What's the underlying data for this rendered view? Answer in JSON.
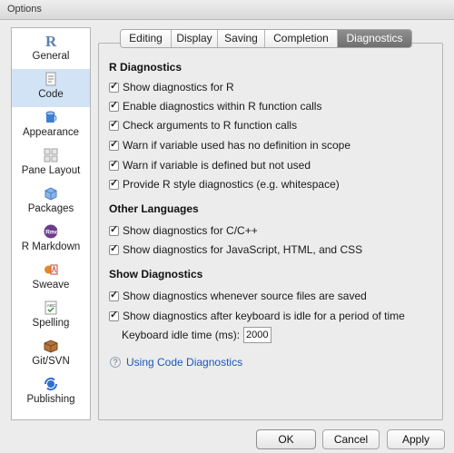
{
  "window": {
    "title": "Options"
  },
  "sidebar": {
    "items": [
      {
        "label": "General",
        "icon": "r-logo-icon",
        "selected": false
      },
      {
        "label": "Code",
        "icon": "code-doc-icon",
        "selected": true
      },
      {
        "label": "Appearance",
        "icon": "paint-bucket-icon",
        "selected": false
      },
      {
        "label": "Pane Layout",
        "icon": "pane-layout-icon",
        "selected": false
      },
      {
        "label": "Packages",
        "icon": "package-box-icon",
        "selected": false
      },
      {
        "label": "R Markdown",
        "icon": "rmd-icon",
        "selected": false
      },
      {
        "label": "Sweave",
        "icon": "sweave-icon",
        "selected": false
      },
      {
        "label": "Spelling",
        "icon": "spellcheck-icon",
        "selected": false
      },
      {
        "label": "Git/SVN",
        "icon": "git-box-icon",
        "selected": false
      },
      {
        "label": "Publishing",
        "icon": "publishing-icon",
        "selected": false
      }
    ]
  },
  "tabs": [
    {
      "label": "Editing",
      "active": false
    },
    {
      "label": "Display",
      "active": false
    },
    {
      "label": "Saving",
      "active": false
    },
    {
      "label": "Completion",
      "active": false
    },
    {
      "label": "Diagnostics",
      "active": true
    }
  ],
  "sections": {
    "r_diagnostics": {
      "title": "R Diagnostics",
      "options": [
        {
          "label": "Show diagnostics for R",
          "checked": true
        },
        {
          "label": "Enable diagnostics within R function calls",
          "checked": true
        },
        {
          "label": "Check arguments to R function calls",
          "checked": true
        },
        {
          "label": "Warn if variable used has no definition in scope",
          "checked": true
        },
        {
          "label": "Warn if variable is defined but not used",
          "checked": true
        },
        {
          "label": "Provide R style diagnostics (e.g. whitespace)",
          "checked": true
        }
      ]
    },
    "other_languages": {
      "title": "Other Languages",
      "options": [
        {
          "label": "Show diagnostics for C/C++",
          "checked": true
        },
        {
          "label": "Show diagnostics for JavaScript, HTML, and CSS",
          "checked": true
        }
      ]
    },
    "show_diagnostics": {
      "title": "Show Diagnostics",
      "options": [
        {
          "label": "Show diagnostics whenever source files are saved",
          "checked": true
        },
        {
          "label": "Show diagnostics after keyboard is idle for a period of time",
          "checked": true
        }
      ]
    }
  },
  "idle_time": {
    "label": "Keyboard idle time (ms):",
    "value": "2000"
  },
  "help": {
    "icon_glyph": "?",
    "link": "Using Code Diagnostics"
  },
  "buttons": {
    "ok": "OK",
    "cancel": "Cancel",
    "apply": "Apply"
  },
  "colors": {
    "selected_bg": "#d3e3f6",
    "link": "#1d58b7",
    "active_tab": "#7c7c7c"
  }
}
